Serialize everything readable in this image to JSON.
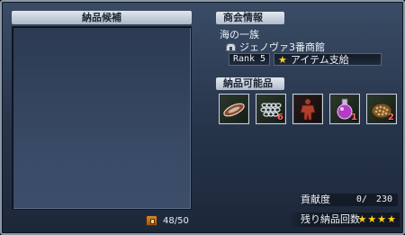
{
  "left_panel": {
    "title": "納品候補",
    "capacity": "48/50",
    "capacity_icon": "chest-icon"
  },
  "info": {
    "title": "商会情報",
    "clan": "海の一族",
    "company": "ジェノヴァ3番商館",
    "company_icon": "building-icon",
    "rank": "Rank 5",
    "support": "アイテム支給",
    "support_icon": "star-icon"
  },
  "items": {
    "title": "納品可能品",
    "slots": [
      {
        "icon": "ship-model-icon",
        "count": ""
      },
      {
        "icon": "chain-icon",
        "count": "6"
      },
      {
        "icon": "armor-figure-icon",
        "count": ""
      },
      {
        "icon": "potion-flask-icon",
        "count": "1"
      },
      {
        "icon": "grain-basket-icon",
        "count": "2"
      }
    ]
  },
  "contribution": {
    "label": "貢献度",
    "value": "0/　230"
  },
  "remaining": {
    "label": "残り納品回数",
    "stars": [
      "★",
      "★",
      "★",
      "★"
    ],
    "star_color": "#ffd21e"
  }
}
